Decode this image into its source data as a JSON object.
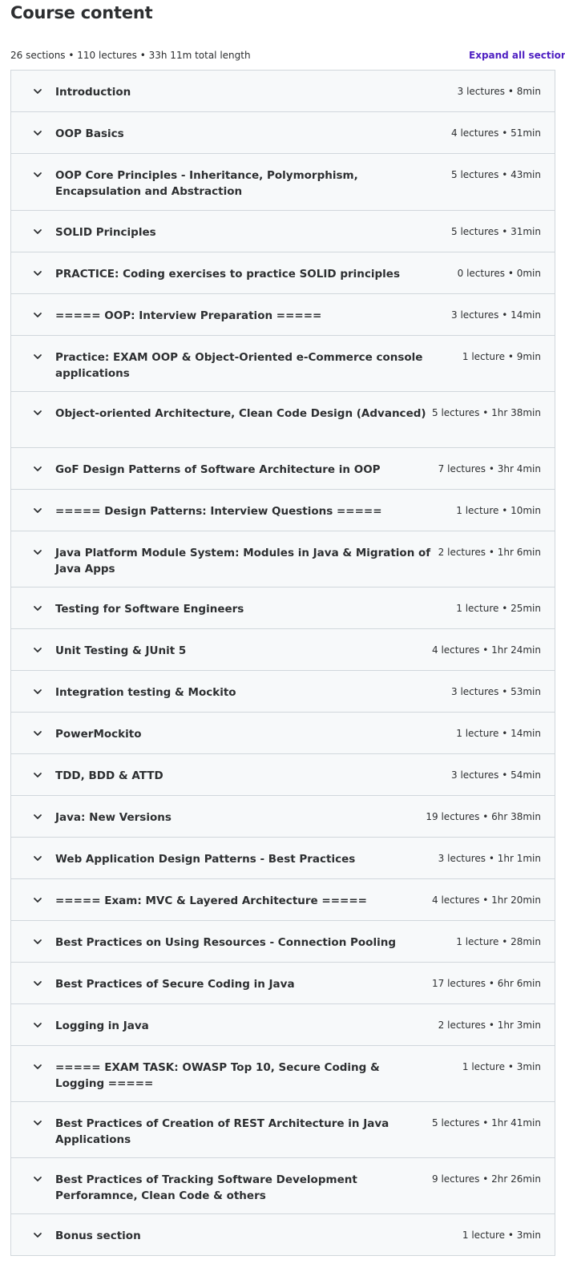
{
  "header": {
    "title": "Course content",
    "summary": "26 sections • 110 lectures • 33h 11m total length",
    "expand_label": "Expand all sections"
  },
  "sections": [
    {
      "title": "Introduction",
      "meta": "3 lectures • 8min"
    },
    {
      "title": "OOP Basics",
      "meta": "4 lectures • 51min"
    },
    {
      "title": "OOP Core Principles - Inheritance, Polymorphism, Encapsulation and Abstraction",
      "meta": "5 lectures • 43min"
    },
    {
      "title": "SOLID Principles",
      "meta": "5 lectures • 31min"
    },
    {
      "title": "PRACTICE: Coding exercises to practice SOLID principles",
      "meta": "0 lectures • 0min"
    },
    {
      "title": "===== OOP: Interview Preparation =====",
      "meta": "3 lectures • 14min"
    },
    {
      "title": "Practice: EXAM OOP & Object-Oriented e-Commerce console applications",
      "meta": "1 lecture • 9min"
    },
    {
      "title": "Object-oriented Architecture, Clean Code Design (Advanced)",
      "meta": "5 lectures • 1hr 38min"
    },
    {
      "title": "GoF Design Patterns of Software Architecture in OOP",
      "meta": "7 lectures • 3hr 4min"
    },
    {
      "title": "===== Design Patterns: Interview Questions =====",
      "meta": "1 lecture • 10min"
    },
    {
      "title": "Java Platform Module System: Modules in Java & Migration of Java Apps",
      "meta": "2 lectures • 1hr 6min"
    },
    {
      "title": "Testing for Software Engineers",
      "meta": "1 lecture • 25min"
    },
    {
      "title": "Unit Testing & JUnit 5",
      "meta": "4 lectures • 1hr 24min"
    },
    {
      "title": "Integration testing & Mockito",
      "meta": "3 lectures • 53min"
    },
    {
      "title": "PowerMockito",
      "meta": "1 lecture • 14min"
    },
    {
      "title": "TDD, BDD & ATTD",
      "meta": "3 lectures • 54min"
    },
    {
      "title": "Java: New Versions",
      "meta": "19 lectures • 6hr 38min"
    },
    {
      "title": "Web Application Design Patterns - Best Practices",
      "meta": "3 lectures • 1hr 1min"
    },
    {
      "title": "===== Exam: MVC & Layered Architecture =====",
      "meta": "4 lectures • 1hr 20min"
    },
    {
      "title": "Best Practices on Using Resources - Connection Pooling",
      "meta": "1 lecture • 28min"
    },
    {
      "title": "Best Practices of Secure Coding in Java",
      "meta": "17 lectures • 6hr 6min"
    },
    {
      "title": "Logging in Java",
      "meta": "2 lectures • 1hr 3min"
    },
    {
      "title": "===== EXAM TASK: OWASP Top 10, Secure Coding & Logging =====",
      "meta": "1 lecture • 3min"
    },
    {
      "title": "Best Practices of Creation of REST Architecture in Java Applications",
      "meta": "5 lectures • 1hr 41min"
    },
    {
      "title": "Best Practices of Tracking Software Development Perforamnce, Clean Code & others",
      "meta": "9 lectures • 2hr 26min"
    },
    {
      "title": "Bonus section",
      "meta": "1 lecture • 3min"
    }
  ],
  "icons": {
    "chevron": "chevron-down-icon"
  },
  "colors": {
    "accent": "#5022c3",
    "section_bg": "#f7f9fa",
    "border": "#d1d7dc",
    "text": "#2d2f31"
  }
}
